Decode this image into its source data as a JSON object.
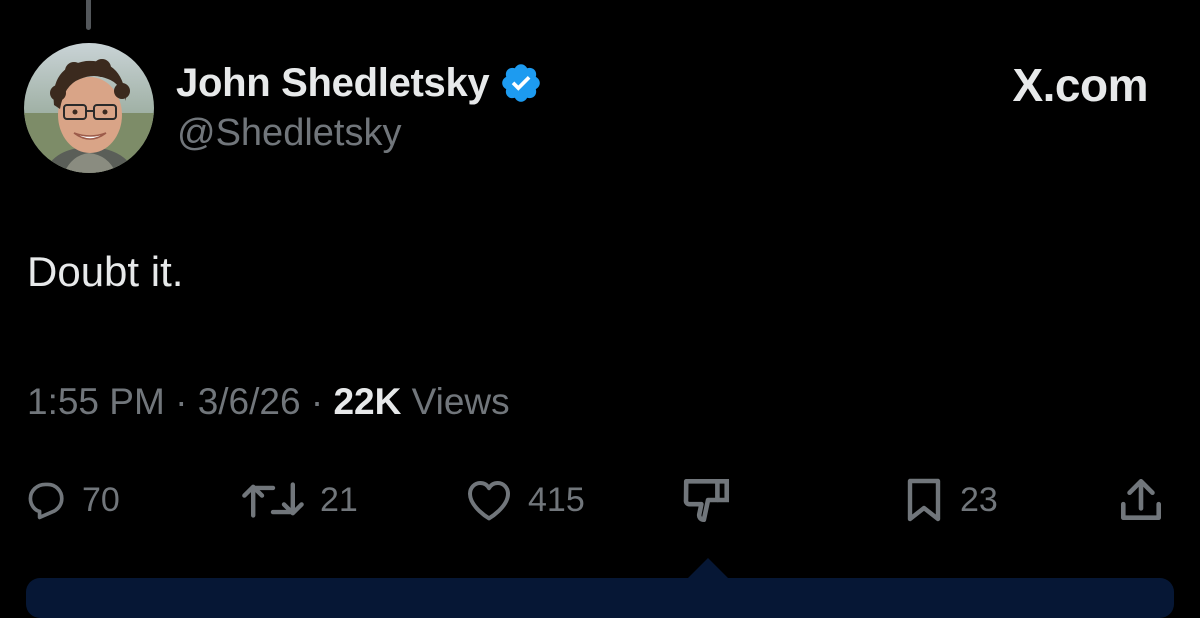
{
  "tweet": {
    "author": {
      "display_name": "John Shedletsky",
      "handle": "@Shedletsky",
      "verified": true
    },
    "brand": "X.com",
    "text": "Doubt it.",
    "meta": {
      "time": "1:55 PM",
      "date": "3/6/26",
      "separator": " · ",
      "views_count": "22K",
      "views_label": " Views"
    }
  },
  "actions": {
    "reply": {
      "icon": "reply-icon",
      "count": "70"
    },
    "retweet": {
      "icon": "retweet-icon",
      "count": "21"
    },
    "like": {
      "icon": "heart-icon",
      "count": "415"
    },
    "dislike": {
      "icon": "thumbs-down-icon"
    },
    "bookmark": {
      "icon": "bookmark-icon",
      "count": "23"
    },
    "share": {
      "icon": "share-icon"
    }
  },
  "colors": {
    "background": "#000000",
    "primary_text": "#e7e9ea",
    "secondary_text": "#71767b",
    "verified_blue": "#1d9bf0",
    "reply_bar": "#061735"
  }
}
